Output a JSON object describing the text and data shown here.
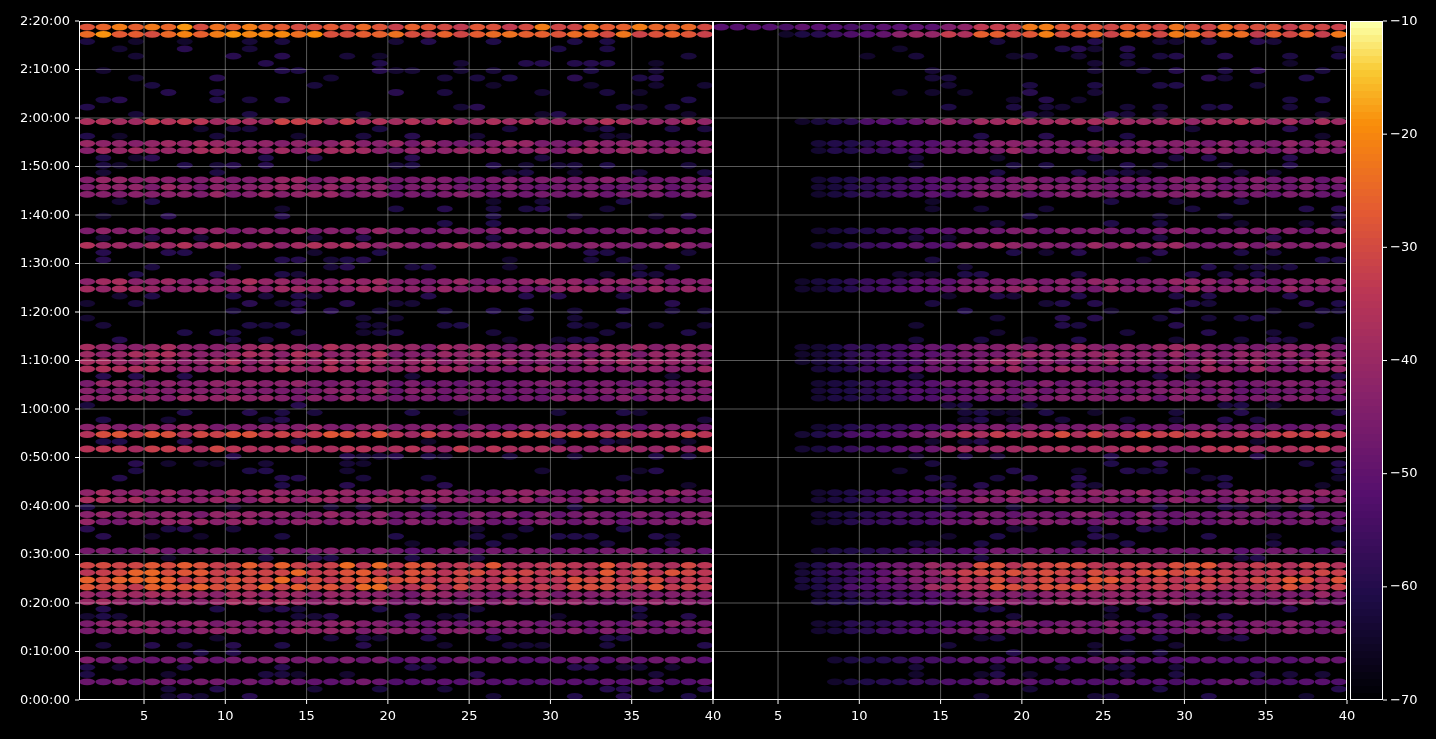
{
  "figure": {
    "panels": [
      {
        "xticks": [
          "5",
          "10",
          "15",
          "20",
          "25",
          "30",
          "35",
          "40"
        ]
      },
      {
        "xticks": [
          "5",
          "10",
          "15",
          "20",
          "25",
          "30",
          "35",
          "40"
        ]
      }
    ],
    "yticks": [
      "2:20:00",
      "2:10:00",
      "2:00:00",
      "1:50:00",
      "1:40:00",
      "1:30:00",
      "1:20:00",
      "1:10:00",
      "1:00:00",
      "0:50:00",
      "0:40:00",
      "0:30:00",
      "0:20:00",
      "0:10:00",
      "0:00:00"
    ],
    "colorbar": {
      "ticks": [
        "−10",
        "−20",
        "−30",
        "−40",
        "−50",
        "−60",
        "−70"
      ]
    }
  }
}
